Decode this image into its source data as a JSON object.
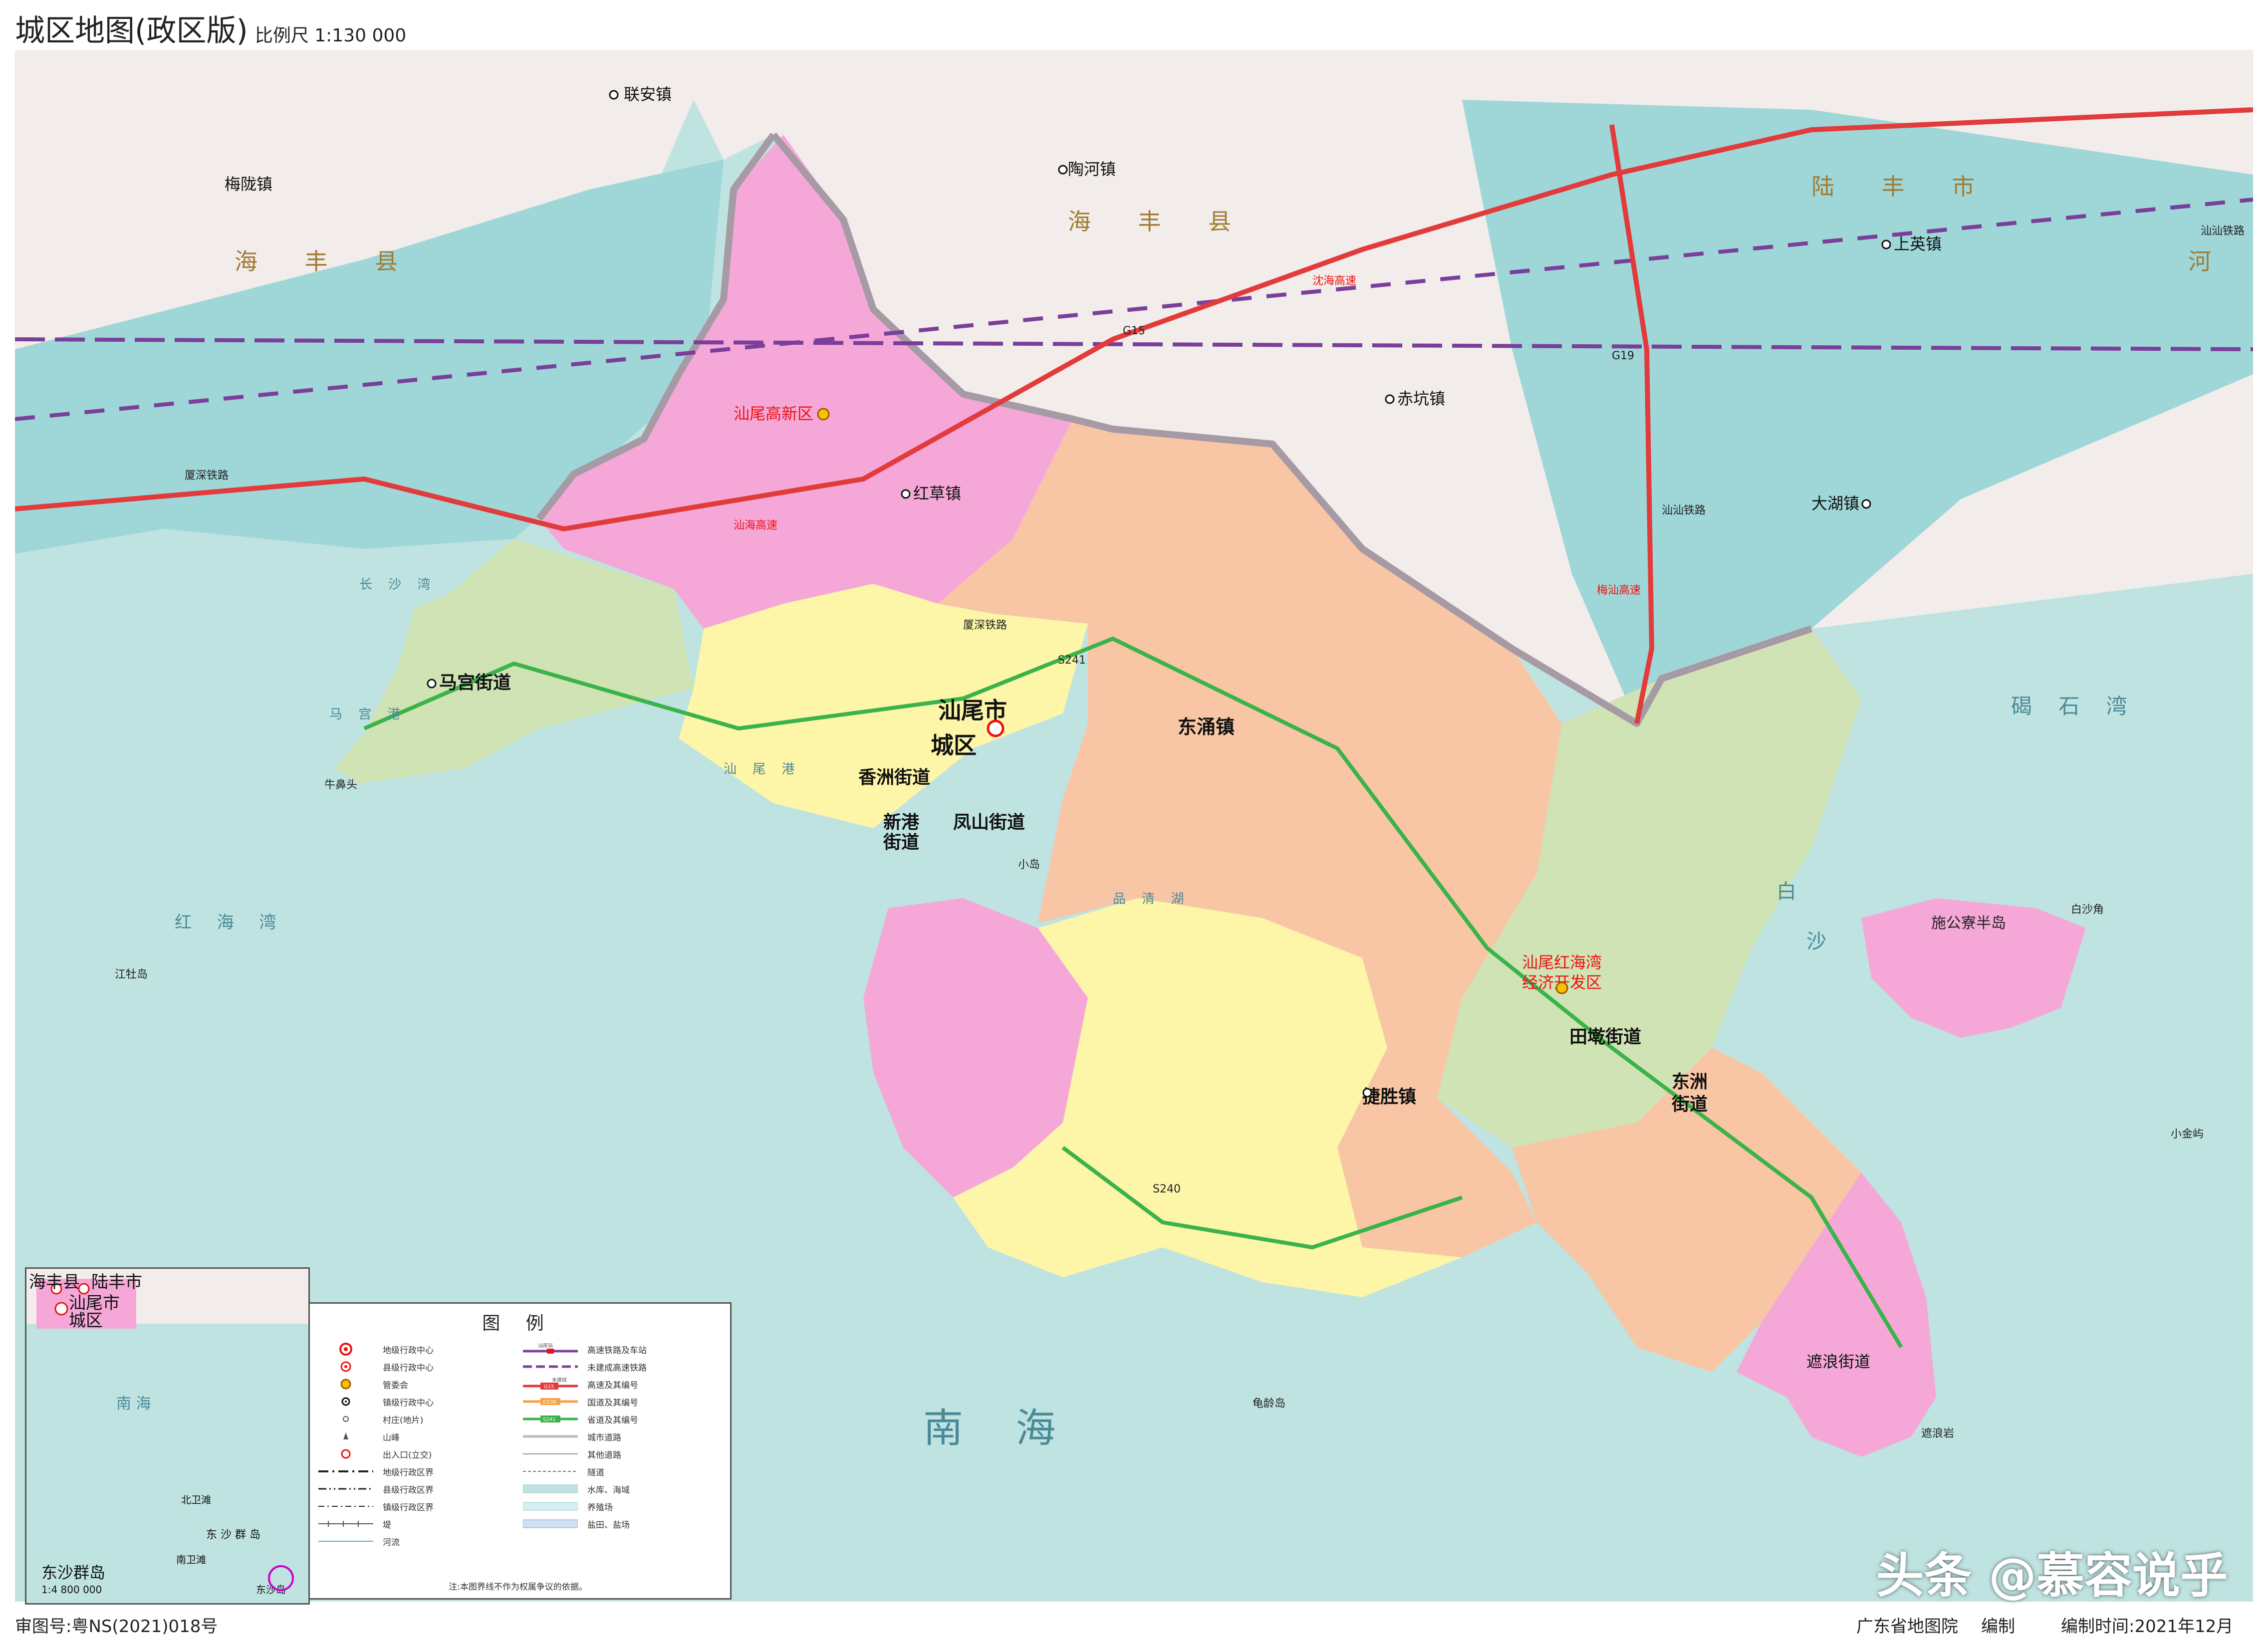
{
  "header": {
    "title": "城区地图(政区版)",
    "scale": "比例尺 1:130 000"
  },
  "footer": {
    "approval": "审图号:粤NS(2021)018号",
    "publisher": "广东省地图院",
    "compiled": "编制",
    "date": "编制时间:2021年12月"
  },
  "watermark": "头条 @慕容说乎",
  "colors": {
    "sea": "#bfe3e1",
    "outside_land": "#f2eceb",
    "coastal_cyan": "#9fd6d8",
    "xinqu_pink": "#f5a8d8",
    "chengqu_yellow": "#fdf5a8",
    "dongyong_orange": "#f8c6a4",
    "green_zone": "#cfe3b4",
    "boundary_gray": "#a69aa4"
  },
  "map": {
    "county_labels": {
      "haifeng_west": "海 丰 县",
      "haifeng_center": "海 丰 县",
      "lufeng": "陆 丰 市",
      "lufeng_river": "河"
    },
    "admin_centers": {
      "shanwei_city": "汕尾市",
      "chengqu": "城区",
      "gaoxinqu": "汕尾高新区",
      "honghaiwan": "汕尾红海湾",
      "honghaiwan2": "经济开发区"
    },
    "towns": {
      "lianan": "联安镇",
      "meilong": "梅陇镇",
      "taohe": "陶河镇",
      "shangying": "上英镇",
      "chikeng": "赤坑镇",
      "dahu": "大湖镇",
      "hongcao": "红草镇",
      "dongyong": "东涌镇",
      "magong": "马宫街道",
      "xiangzhou": "香洲街道",
      "xingang": "新港",
      "xingang2": "街道",
      "fengshan": "凤山街道",
      "jiesheng": "捷胜镇",
      "tiancuo": "田墘街道",
      "dongzhou": "东洲",
      "dongzhou2": "街道",
      "zhelang": "遮浪街道"
    },
    "sea_labels": {
      "nanhai": "南 海",
      "zheshiwan": "碣 石 湾",
      "hongwan": "红 海 湾",
      "changshawan": "长 沙 湾",
      "shanweigang": "汕 尾 港",
      "magonggang": "马 宫 港",
      "pinqinghu": "品 清 湖",
      "bai": "白",
      "sha": "沙"
    },
    "islands": {
      "jiangmu": "江牡岛",
      "shigonglai": "施公寮半岛",
      "baishajiao": "白沙角",
      "xiaohuangshen": "小金屿",
      "guitouwei": "龟龄岛",
      "zhelangyan": "遮浪岩",
      "niubitou": "牛鼻头",
      "xiaodao": "小岛"
    },
    "road_labels": {
      "g15": "G15",
      "s241": "S241",
      "s240": "S240",
      "g19": "G19",
      "hanshen_rail": "厦深铁路",
      "hanshen_rail2": "厦深铁路",
      "shanshan_rail": "汕汕铁路",
      "shanshan_rail2": "汕汕铁路",
      "shenhai": "沈海高速",
      "shanhai": "汕海高速",
      "meilong_gaosu": "梅汕高速"
    }
  },
  "legend": {
    "title": "图 例",
    "items_left": [
      "地级行政中心",
      "县级行政中心",
      "管委会",
      "镇级行政中心",
      "村庄(地片)",
      "山峰",
      "出入口(立交)",
      "地级行政区界",
      "县级行政区界",
      "镇级行政区界",
      "堤",
      "河流"
    ],
    "items_right": [
      "高速铁路及车站",
      "未建成高速铁路",
      "高速及其编号",
      "国道及其编号",
      "省道及其编号",
      "城市道路",
      "其他道路",
      "隧道",
      "水库、海域",
      "养殖场",
      "盐田、盐场"
    ],
    "station_sample": "汕尾站",
    "unbuilt_sample": "未建成",
    "g15_sample": "G15",
    "g236_sample": "G236",
    "s241_sample": "S241",
    "note": "注:本图界线不作为权属争议的依据。"
  },
  "inset": {
    "place1": "海丰县",
    "place2": "陆丰市",
    "place3": "城区",
    "place4": "汕尾市",
    "sea": "南 海",
    "title": "东沙群岛",
    "scale": "1:4 800 000",
    "isl1": "北卫滩",
    "isl2": "东 沙 群 岛",
    "isl3": "南卫滩",
    "isl4": "东沙岛"
  }
}
